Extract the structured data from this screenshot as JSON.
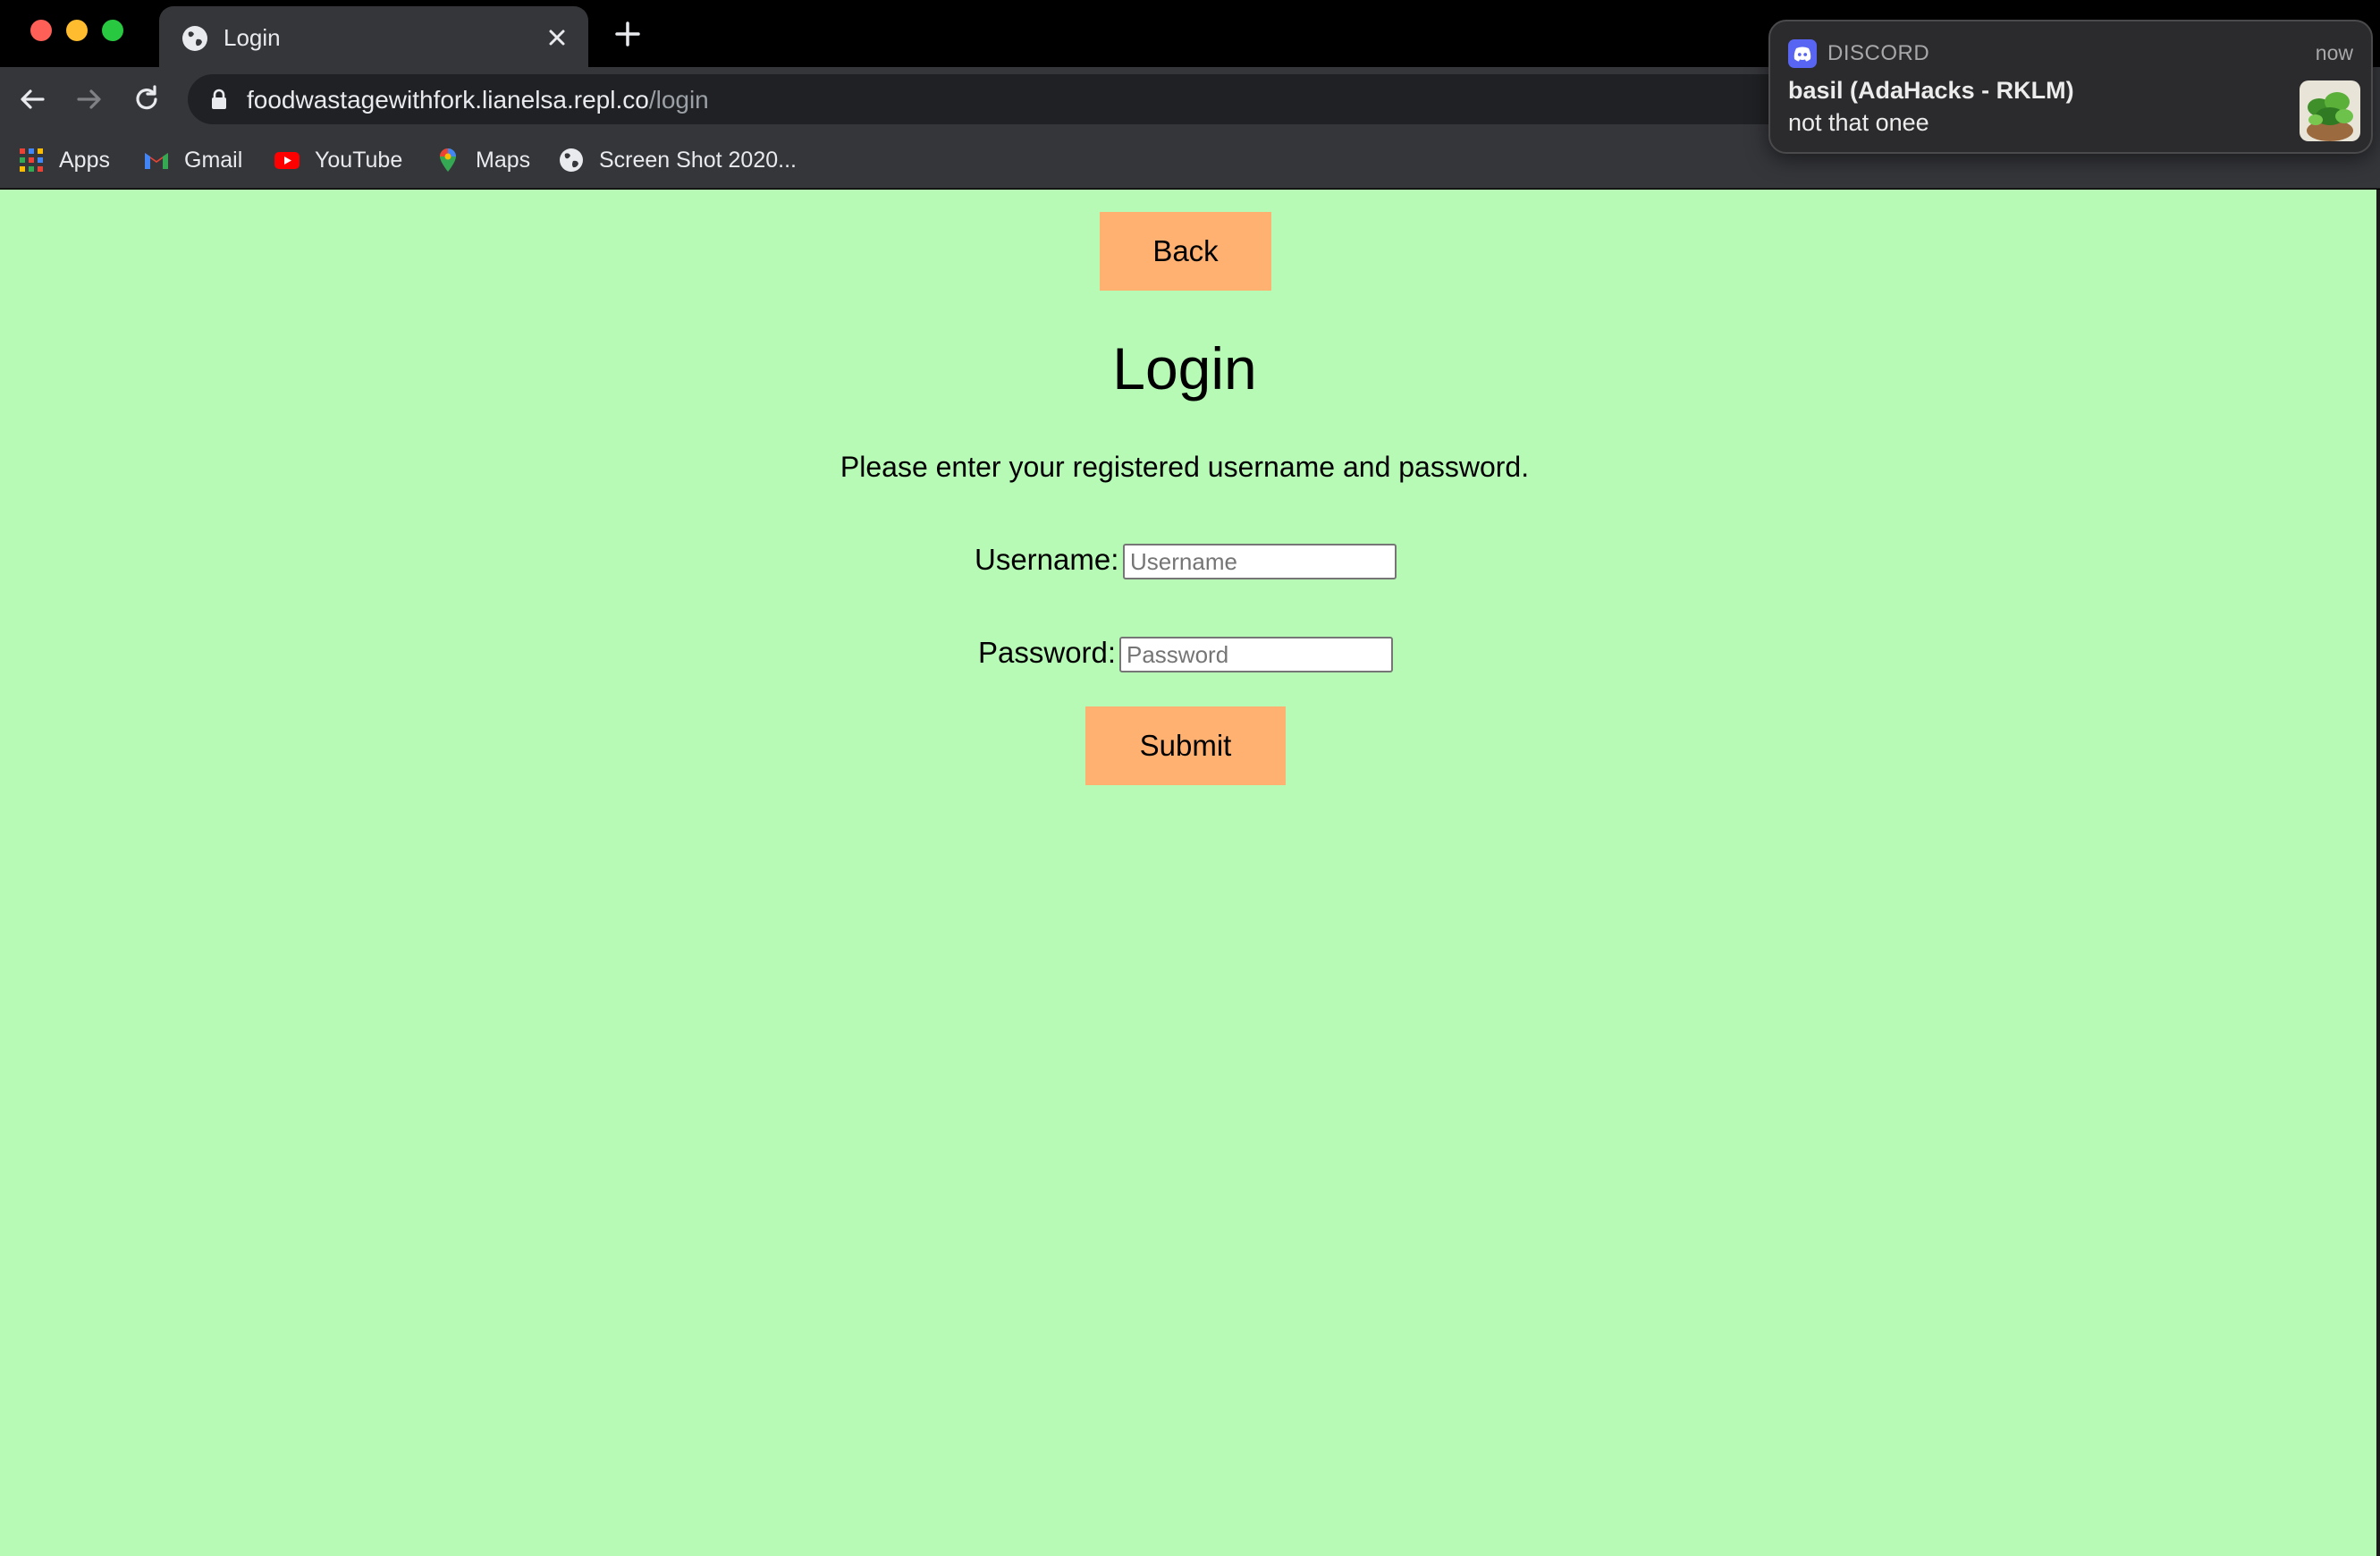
{
  "browser": {
    "tab": {
      "title": "Login",
      "favicon": "globe-icon"
    },
    "url": {
      "host": "foodwastagewithfork.lianelsa.repl.co",
      "path": "/login"
    },
    "bookmarks": [
      {
        "label": "Apps",
        "icon": "apps-grid-icon"
      },
      {
        "label": "Gmail",
        "icon": "gmail-icon"
      },
      {
        "label": "YouTube",
        "icon": "youtube-icon"
      },
      {
        "label": "Maps",
        "icon": "maps-pin-icon"
      },
      {
        "label": "Screen Shot 2020...",
        "icon": "globe-icon"
      }
    ]
  },
  "page": {
    "back_label": "Back",
    "title": "Login",
    "subtitle": "Please enter your registered username and password.",
    "username": {
      "label": "Username:",
      "placeholder": "Username",
      "value": ""
    },
    "password": {
      "label": "Password:",
      "placeholder": "Password",
      "value": ""
    },
    "submit_label": "Submit",
    "colors": {
      "background": "#b6fab6",
      "button": "#ffb171"
    }
  },
  "notification": {
    "app": "DISCORD",
    "time": "now",
    "title": "basil (AdaHacks - RKLM)",
    "message": "not that onee",
    "icon": "discord-icon"
  }
}
